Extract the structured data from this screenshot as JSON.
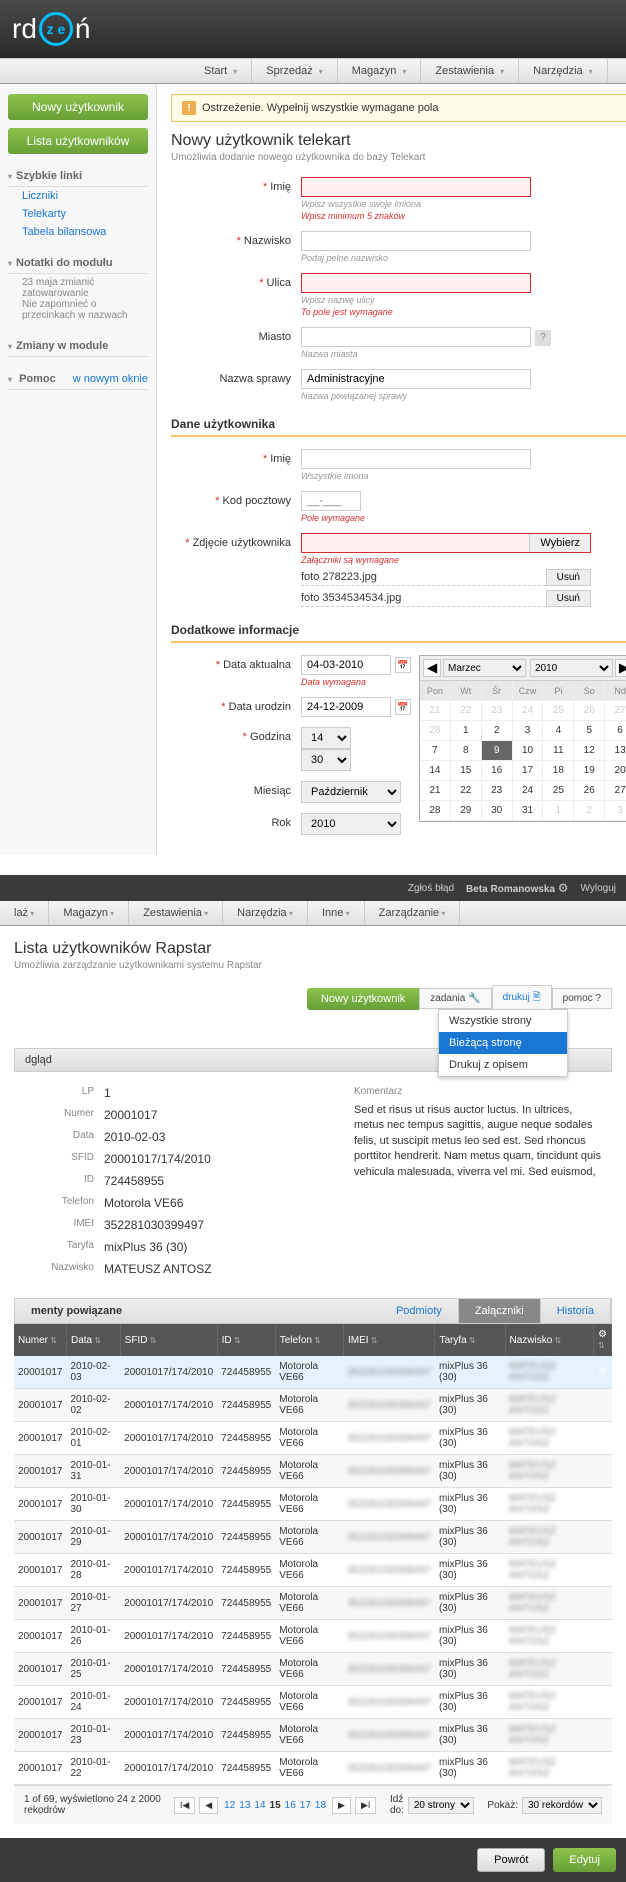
{
  "logo_pre": "rd",
  "logo_post": "ń",
  "logo_ring": "z e",
  "mainnav": [
    "Start",
    "Sprzedaż",
    "Magazyn",
    "Zestawienia",
    "Narzędzia"
  ],
  "sidebar": {
    "btn_new": "Nowy użytkownik",
    "btn_list": "Lista użytkowników",
    "quick_head": "Szybkie linki",
    "quick_links": [
      "Liczniki",
      "Telekarty",
      "Tabela bilansowa"
    ],
    "notes_head": "Notatki do modułu",
    "notes_text": "23 maja zmianić zatowarowanie\nNie zapomnieć o przecinkach w nazwach",
    "changes_head": "Zmiany w module",
    "help_head": "Pomoc",
    "help_link": "w nowym oknie"
  },
  "warning": "Ostrzeżenie. Wypełnij wszystkie wymagane pola",
  "page_title": "Nowy użytkownik telekart",
  "page_sub": "Umożliwia dodanie nowego użytkownika do bazy Telekart",
  "form": {
    "fname_label": "Imię",
    "fname_hint1": "Wpisz wszystkie swoje imiona",
    "fname_hint2": "Wpisz minimum 5 znaków",
    "lname_label": "Nazwisko",
    "lname_hint": "Podaj pełne nazwisko",
    "street_label": "Ulica",
    "street_hint1": "Wpisz nazwę ulicy",
    "street_hint2": "To pole jest wymagane",
    "city_label": "Miasto",
    "city_hint": "Nazwa miasta",
    "case_label": "Nazwa sprawy",
    "case_value": "Administracyjne",
    "case_hint": "Nazwa powiązanej sprawy",
    "section_user": "Dane użytkownika",
    "uname_label": "Imię",
    "uname_hint": "Wszystkie imona",
    "zip_label": "Kod pocztowy",
    "zip_placeholder": "__-___",
    "zip_hint": "Pole wymagane",
    "photo_label": "Zdjęcie użytkownika",
    "photo_btn": "Wybierz",
    "photo_hint": "Załączniki są wymagane",
    "file1": "foto 278223.jpg",
    "file2": "foto 3534534534.jpg",
    "file_del": "Usuń",
    "section_extra": "Dodatkowe informacje",
    "date_curr_label": "Data aktualna",
    "date_curr_val": "04-03-2010",
    "date_curr_hint": "Data wymagana",
    "date_birth_label": "Data urodzin",
    "date_birth_val": "24-12-2009",
    "hour_label": "Godzina",
    "hour_val": "14",
    "min_val": "30",
    "month_label": "Miesiąc",
    "month_val": "Październik",
    "year_label": "Rok",
    "year_val": "2010"
  },
  "calendar": {
    "month": "Marzec",
    "year": "2010",
    "days": [
      "Pon",
      "Wt",
      "Śr",
      "Czw",
      "Pi",
      "So",
      "Nd"
    ],
    "weeks": [
      {
        "off": true,
        "d": [
          21,
          22,
          23,
          24,
          25,
          26,
          27
        ]
      },
      {
        "off": false,
        "d": [
          28,
          1,
          2,
          3,
          4,
          5,
          6
        ],
        "firstOff": true
      },
      {
        "off": false,
        "d": [
          7,
          8,
          9,
          10,
          11,
          12,
          13
        ],
        "sel": 9
      },
      {
        "off": false,
        "d": [
          14,
          15,
          16,
          17,
          18,
          19,
          20
        ]
      },
      {
        "off": false,
        "d": [
          21,
          22,
          23,
          24,
          25,
          26,
          27
        ]
      },
      {
        "off": false,
        "d": [
          28,
          29,
          30,
          31,
          1,
          2,
          3
        ],
        "lastOff": 3
      }
    ]
  },
  "topbar2": {
    "report": "Zgłoś błąd",
    "user": "Beta Romanowska",
    "logout": "Wyloguj"
  },
  "mainnav2": [
    "laż",
    "Magazyn",
    "Zestawienia",
    "Narzędzia",
    "Inne",
    "Zarządzanie"
  ],
  "list_title": "Lista użytkowników Rapstar",
  "list_sub": "Umożliwia zarządzanie użytkownikami systemu Rapstar",
  "toolbar": {
    "new": "Nowy użytkownik",
    "tasks": "zadania",
    "print": "drukuj",
    "help": "pomoc ?"
  },
  "dropdown": {
    "all": "Wszystkie strony",
    "current": "Bieżącą stronę",
    "desc": "Drukuj z opisem"
  },
  "section_bar": "dgląd",
  "details": {
    "lp_l": "LP",
    "lp_v": "1",
    "num_l": "Numer",
    "num_v": "20001017",
    "date_l": "Data",
    "date_v": "2010-02-03",
    "sfid_l": "SFID",
    "sfid_v": "20001017/174/2010",
    "id_l": "ID",
    "id_v": "724458955",
    "tel_l": "Telefon",
    "tel_v": "Motorola VE66",
    "imei_l": "IMEI",
    "imei_v": "352281030399497",
    "tar_l": "Taryfa",
    "tar_v": "mixPlus 36 (30)",
    "name_l": "Nazwisko",
    "name_v": "MATEUSZ ANTOSZ",
    "comment_l": "Komentarz",
    "comment": "Sed et risus ut risus auctor luctus. In ultrices, metus nec tempus sagittis, augue neque sodales felis, ut suscipit metus leo sed est. Sed rhoncus porttitor hendrerit. Nam metus quam, tincidunt quis vehicula malesuada, viverra vel mi. Sed euismod,"
  },
  "tabs2_head": "menty powiązane",
  "tabs2": {
    "pod": "Podmioty",
    "zal": "Załączniki",
    "hist": "Historia"
  },
  "table": {
    "headers": [
      "Numer",
      "Data",
      "SFID",
      "ID",
      "Telefon",
      "IMEI",
      "Taryfa",
      "Nazwisko"
    ],
    "rows": [
      {
        "sel": true,
        "num": "20001017",
        "date": "2010-02-03",
        "sfid": "20001017/174/2010",
        "id": "724458955",
        "tel": "Motorola VE66",
        "tar": "mixPlus 36 (30)"
      },
      {
        "num": "20001017",
        "date": "2010-02-02",
        "sfid": "20001017/174/2010",
        "id": "724458955",
        "tel": "Motorola VE66",
        "tar": "mixPlus 36 (30)"
      },
      {
        "num": "20001017",
        "date": "2010-02-01",
        "sfid": "20001017/174/2010",
        "id": "724458955",
        "tel": "Motorola VE66",
        "tar": "mixPlus 36 (30)"
      },
      {
        "num": "20001017",
        "date": "2010-01-31",
        "sfid": "20001017/174/2010",
        "id": "724458955",
        "tel": "Motorola VE66",
        "tar": "mixPlus 36 (30)"
      },
      {
        "num": "20001017",
        "date": "2010-01-30",
        "sfid": "20001017/174/2010",
        "id": "724458955",
        "tel": "Motorola VE66",
        "tar": "mixPlus 36 (30)"
      },
      {
        "num": "20001017",
        "date": "2010-01-29",
        "sfid": "20001017/174/2010",
        "id": "724458955",
        "tel": "Motorola VE66",
        "tar": "mixPlus 36 (30)"
      },
      {
        "num": "20001017",
        "date": "2010-01-28",
        "sfid": "20001017/174/2010",
        "id": "724458955",
        "tel": "Motorola VE66",
        "tar": "mixPlus 36 (30)"
      },
      {
        "num": "20001017",
        "date": "2010-01-27",
        "sfid": "20001017/174/2010",
        "id": "724458955",
        "tel": "Motorola VE66",
        "tar": "mixPlus 36 (30)"
      },
      {
        "num": "20001017",
        "date": "2010-01-26",
        "sfid": "20001017/174/2010",
        "id": "724458955",
        "tel": "Motorola VE66",
        "tar": "mixPlus 36 (30)"
      },
      {
        "num": "20001017",
        "date": "2010-01-25",
        "sfid": "20001017/174/2010",
        "id": "724458955",
        "tel": "Motorola VE66",
        "tar": "mixPlus 36 (30)"
      },
      {
        "num": "20001017",
        "date": "2010-01-24",
        "sfid": "20001017/174/2010",
        "id": "724458955",
        "tel": "Motorola VE66",
        "tar": "mixPlus 36 (30)"
      },
      {
        "num": "20001017",
        "date": "2010-01-23",
        "sfid": "20001017/174/2010",
        "id": "724458955",
        "tel": "Motorola VE66",
        "tar": "mixPlus 36 (30)"
      },
      {
        "num": "20001017",
        "date": "2010-01-22",
        "sfid": "20001017/174/2010",
        "id": "724458955",
        "tel": "Motorola VE66",
        "tar": "mixPlus 36 (30)"
      }
    ]
  },
  "pager": {
    "info": "1 of 69, wyświetlono 24 z 2000 rekodrów",
    "pages": [
      "12",
      "13",
      "14",
      "15",
      "16",
      "17",
      "18"
    ],
    "current": "15",
    "goto_l": "Idź do:",
    "goto_v": "20 strony",
    "show_l": "Pokaż:",
    "show_v": "30 rekordów"
  },
  "footer": {
    "back": "Powrót",
    "edit": "Edytuj"
  }
}
